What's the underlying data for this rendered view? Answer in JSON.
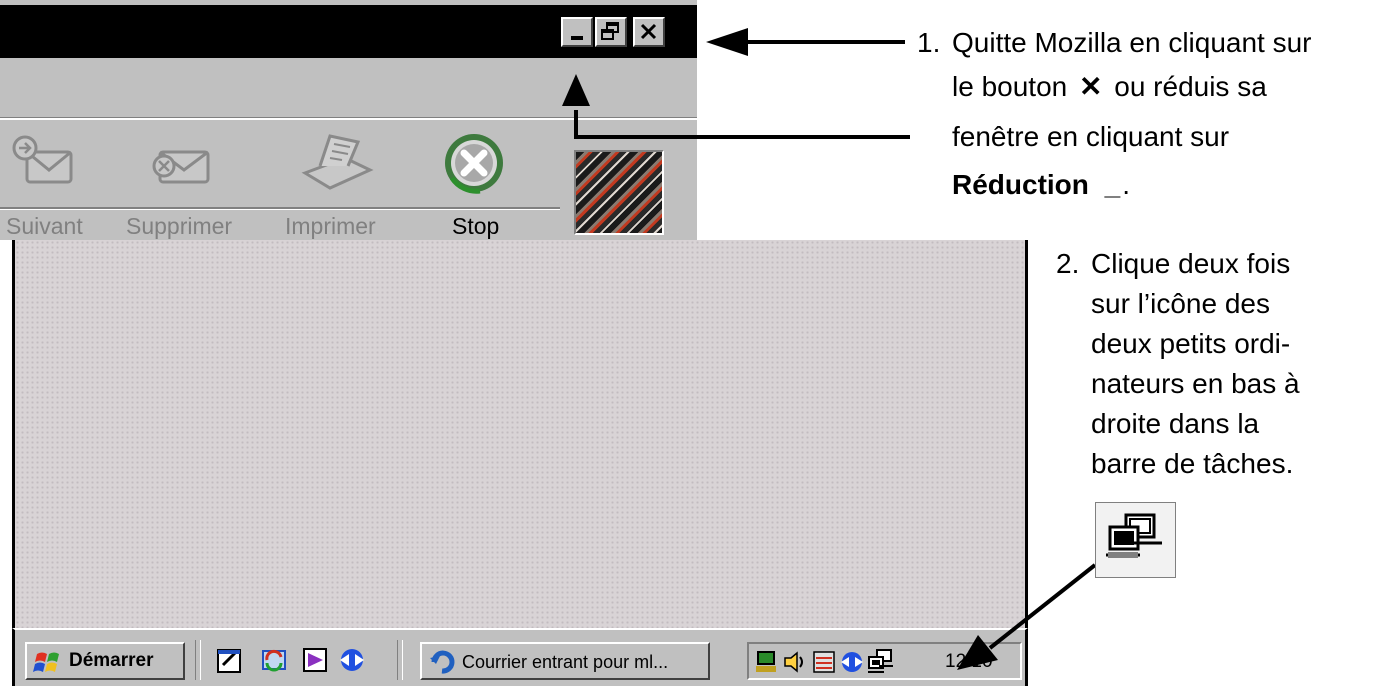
{
  "toolbar": {
    "suivant_label": "Suivant",
    "supprimer_label": "Supprimer",
    "imprimer_label": "Imprimer",
    "stop_label": "Stop"
  },
  "taskbar": {
    "start_label": "Démarrer",
    "task_label": "Courrier entrant pour ml...",
    "clock": "12:10"
  },
  "annotations": {
    "step1": {
      "number": "1.",
      "line1": "Quitte Mozilla en cliquant sur",
      "line2_before": "le bouton",
      "line2_symbol": "✕",
      "line2_after": "ou réduis sa",
      "line3": "fenêtre en cliquant sur",
      "line4_bold": "Réduction",
      "line4_symbol": "_",
      "line4_end": "."
    },
    "step2": {
      "number": "2.",
      "lines": [
        "Clique deux fois",
        "sur l’icône des",
        "deux petits ordi-",
        "nateurs en bas à",
        "droite dans la",
        "barre de tâches."
      ]
    }
  },
  "icons": {
    "suivant": "envelope-forward-icon",
    "supprimer": "envelope-delete-icon",
    "imprimer": "printer-icon",
    "stop": "stop-icon",
    "throbber": "mozilla-throbber-icon",
    "network": "network-computers-icon"
  }
}
